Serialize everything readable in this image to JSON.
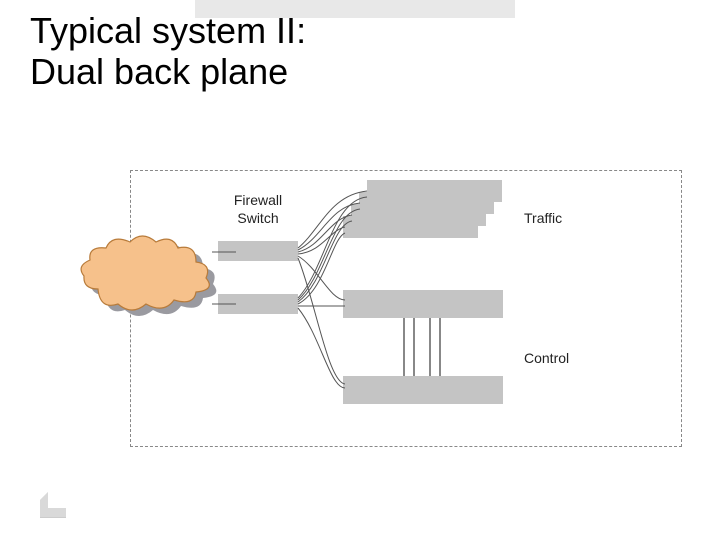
{
  "title_line1": "Typical system II:",
  "title_line2": "Dual back plane",
  "labels": {
    "firewall_switch": "Firewall\nSwitch",
    "traffic": "Traffic",
    "control": "Control"
  },
  "colors": {
    "cloud_fill": "#f6c18b",
    "cloud_stroke": "#b87b3a",
    "box_fill": "#c4c4c4",
    "dashed_border": "#888888"
  },
  "diagram": {
    "stacked_count": 4,
    "switch_count": 2
  }
}
